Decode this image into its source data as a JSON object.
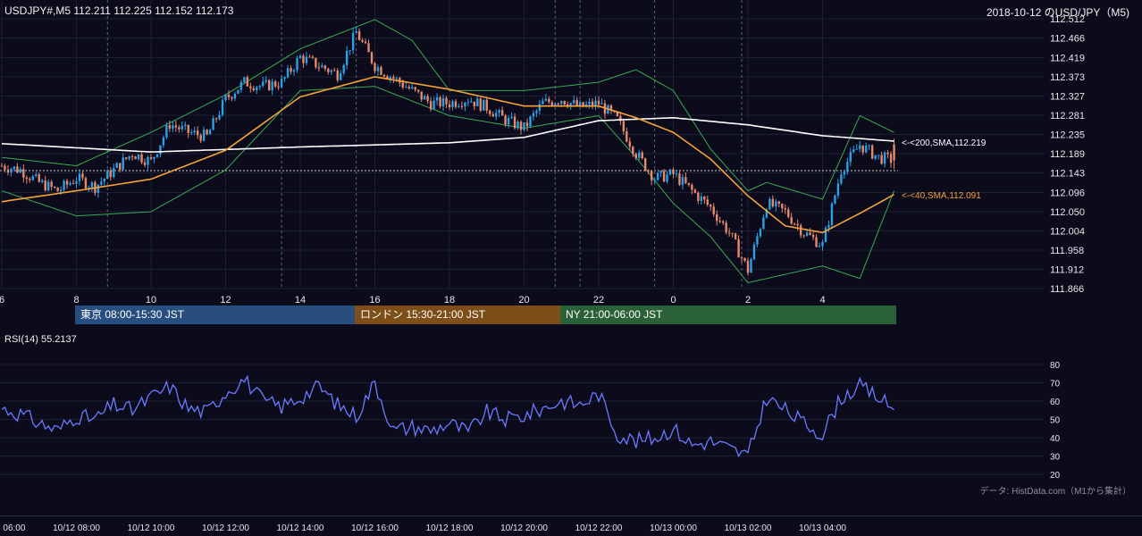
{
  "header": {
    "ohlc_label": "USDJPY#,M5 112.211 112.225 112.152 112.173",
    "title_right": "2018-10-12 のUSD/JPY（M5)"
  },
  "price_axis": {
    "ticks": [
      "112.512",
      "112.466",
      "112.419",
      "112.373",
      "112.327",
      "112.281",
      "112.235",
      "112.189",
      "112.143",
      "112.096",
      "112.050",
      "112.004",
      "111.958",
      "111.912",
      "111.866"
    ]
  },
  "hour_axis": {
    "ticks": [
      "6",
      "8",
      "10",
      "12",
      "14",
      "16",
      "18",
      "20",
      "22",
      "0",
      "2",
      "4"
    ]
  },
  "sessions": [
    {
      "label": "東京 08:00-15:30 JST",
      "color": "#274e7e"
    },
    {
      "label": "ロンドン 15:30-21:00 JST",
      "color": "#7d4e17"
    },
    {
      "label": "NY 21:00-06:00 JST",
      "color": "#2a6136"
    }
  ],
  "ma_labels": {
    "sma200": "<-<200,SMA,112.219",
    "sma40": "<-<40,SMA,112.091"
  },
  "colors": {
    "up": "#2aa0e6",
    "down": "#e8896c",
    "sma200": "#ffffff",
    "sma40": "#f5a13a",
    "bollinger": "#3aaa52",
    "rsi": "#6a7bff",
    "vertical_dash": "#7a8aa8"
  },
  "rsi": {
    "label": "RSI(14) 55.2137",
    "ticks": [
      "80",
      "70",
      "60",
      "50",
      "40",
      "30",
      "20"
    ]
  },
  "source_note": "データ: HistData.com（M1から集計）",
  "date_axis": {
    "ticks": [
      "10/12 06:00",
      "10/12 08:00",
      "10/12 10:00",
      "10/12 12:00",
      "10/12 14:00",
      "10/12 16:00",
      "10/12 18:00",
      "10/12 20:00",
      "10/12 22:00",
      "10/13 00:00",
      "10/13 02:00",
      "10/13 04:00"
    ]
  },
  "chart_data": [
    {
      "type": "candlestick",
      "title": "USDJPY#,M5",
      "ylim": [
        111.866,
        112.512
      ],
      "last": {
        "open": 112.211,
        "high": 112.225,
        "low": 112.152,
        "close": 112.173
      },
      "close_path": [
        [
          "06:00",
          112.16
        ],
        [
          "06:30",
          112.15
        ],
        [
          "07:00",
          112.12
        ],
        [
          "07:30",
          112.1
        ],
        [
          "08:00",
          112.13
        ],
        [
          "08:30",
          112.11
        ],
        [
          "09:00",
          112.15
        ],
        [
          "09:30",
          112.19
        ],
        [
          "10:00",
          112.17
        ],
        [
          "10:30",
          112.26
        ],
        [
          "11:00",
          112.24
        ],
        [
          "11:30",
          112.23
        ],
        [
          "12:00",
          112.32
        ],
        [
          "12:30",
          112.36
        ],
        [
          "13:00",
          112.35
        ],
        [
          "13:30",
          112.36
        ],
        [
          "14:00",
          112.42
        ],
        [
          "14:30",
          112.4
        ],
        [
          "15:00",
          112.38
        ],
        [
          "15:30",
          112.48
        ],
        [
          "16:00",
          112.4
        ],
        [
          "16:30",
          112.37
        ],
        [
          "17:00",
          112.34
        ],
        [
          "17:30",
          112.31
        ],
        [
          "18:00",
          112.31
        ],
        [
          "18:30",
          112.32
        ],
        [
          "19:00",
          112.3
        ],
        [
          "19:30",
          112.27
        ],
        [
          "20:00",
          112.25
        ],
        [
          "20:30",
          112.31
        ],
        [
          "21:00",
          112.32
        ],
        [
          "21:30",
          112.3
        ],
        [
          "22:00",
          112.31
        ],
        [
          "22:30",
          112.27
        ],
        [
          "23:00",
          112.19
        ],
        [
          "23:30",
          112.13
        ],
        [
          "00:00",
          112.14
        ],
        [
          "00:30",
          112.1
        ],
        [
          "01:00",
          112.06
        ],
        [
          "01:30",
          112.0
        ],
        [
          "02:00",
          111.91
        ],
        [
          "02:30",
          112.07
        ],
        [
          "03:00",
          112.05
        ],
        [
          "03:30",
          112.0
        ],
        [
          "04:00",
          111.97
        ],
        [
          "04:30",
          112.15
        ],
        [
          "05:00",
          112.21
        ],
        [
          "05:30",
          112.18
        ],
        [
          "05:55",
          112.173
        ]
      ],
      "sma200": [
        [
          "06:00",
          112.213
        ],
        [
          "10:00",
          112.193
        ],
        [
          "14:00",
          112.205
        ],
        [
          "18:00",
          112.215
        ],
        [
          "20:00",
          112.228
        ],
        [
          "22:00",
          112.268
        ],
        [
          "00:00",
          112.275
        ],
        [
          "02:00",
          112.258
        ],
        [
          "04:00",
          112.232
        ],
        [
          "05:55",
          112.219
        ]
      ],
      "sma40": [
        [
          "06:00",
          112.074
        ],
        [
          "08:00",
          112.1
        ],
        [
          "10:00",
          112.128
        ],
        [
          "12:00",
          112.197
        ],
        [
          "14:00",
          112.325
        ],
        [
          "16:00",
          112.373
        ],
        [
          "18:00",
          112.343
        ],
        [
          "20:00",
          112.303
        ],
        [
          "22:00",
          112.303
        ],
        [
          "23:00",
          112.275
        ],
        [
          "00:00",
          112.24
        ],
        [
          "01:00",
          112.176
        ],
        [
          "02:00",
          112.088
        ],
        [
          "03:00",
          112.016
        ],
        [
          "04:00",
          112.0
        ],
        [
          "05:00",
          112.046
        ],
        [
          "05:55",
          112.091
        ]
      ],
      "bollinger_upper": [
        [
          "06:00",
          112.18
        ],
        [
          "08:00",
          112.16
        ],
        [
          "10:00",
          112.24
        ],
        [
          "12:00",
          112.33
        ],
        [
          "14:00",
          112.44
        ],
        [
          "16:00",
          112.51
        ],
        [
          "17:00",
          112.46
        ],
        [
          "18:00",
          112.34
        ],
        [
          "20:00",
          112.34
        ],
        [
          "22:00",
          112.36
        ],
        [
          "23:00",
          112.39
        ],
        [
          "00:00",
          112.34
        ],
        [
          "01:00",
          112.2
        ],
        [
          "02:00",
          112.1
        ],
        [
          "02:30",
          112.12
        ],
        [
          "04:00",
          112.08
        ],
        [
          "05:00",
          112.28
        ],
        [
          "05:55",
          112.24
        ]
      ],
      "bollinger_lower": [
        [
          "06:00",
          112.1
        ],
        [
          "08:00",
          112.04
        ],
        [
          "10:00",
          112.05
        ],
        [
          "12:00",
          112.15
        ],
        [
          "14:00",
          112.34
        ],
        [
          "16:00",
          112.35
        ],
        [
          "18:00",
          112.28
        ],
        [
          "20:00",
          112.25
        ],
        [
          "22:00",
          112.28
        ],
        [
          "23:00",
          112.18
        ],
        [
          "00:00",
          112.07
        ],
        [
          "01:00",
          111.99
        ],
        [
          "02:00",
          111.88
        ],
        [
          "03:00",
          111.9
        ],
        [
          "04:00",
          111.92
        ],
        [
          "05:00",
          111.89
        ],
        [
          "05:55",
          112.1
        ]
      ]
    },
    {
      "type": "line",
      "title": "RSI(14)",
      "ylim": [
        20,
        80
      ],
      "last": 55.2137,
      "x": [
        "06:00",
        "06:30",
        "07:00",
        "07:30",
        "08:00",
        "08:30",
        "09:00",
        "09:30",
        "10:00",
        "10:30",
        "11:00",
        "11:30",
        "12:00",
        "12:30",
        "13:00",
        "13:30",
        "14:00",
        "14:30",
        "15:00",
        "15:30",
        "16:00",
        "16:30",
        "17:00",
        "17:30",
        "18:00",
        "18:30",
        "19:00",
        "19:30",
        "20:00",
        "20:30",
        "21:00",
        "21:30",
        "22:00",
        "22:30",
        "23:00",
        "23:30",
        "00:00",
        "00:30",
        "01:00",
        "01:30",
        "02:00",
        "02:30",
        "03:00",
        "03:30",
        "04:00",
        "04:30",
        "05:00",
        "05:30",
        "05:55"
      ],
      "values": [
        56,
        53,
        48,
        44,
        52,
        50,
        58,
        55,
        62,
        68,
        56,
        54,
        65,
        72,
        60,
        57,
        62,
        68,
        58,
        52,
        70,
        44,
        46,
        44,
        48,
        43,
        54,
        50,
        52,
        56,
        60,
        58,
        64,
        42,
        38,
        40,
        45,
        36,
        38,
        34,
        30,
        62,
        55,
        48,
        42,
        62,
        68,
        62,
        55.2
      ]
    }
  ]
}
